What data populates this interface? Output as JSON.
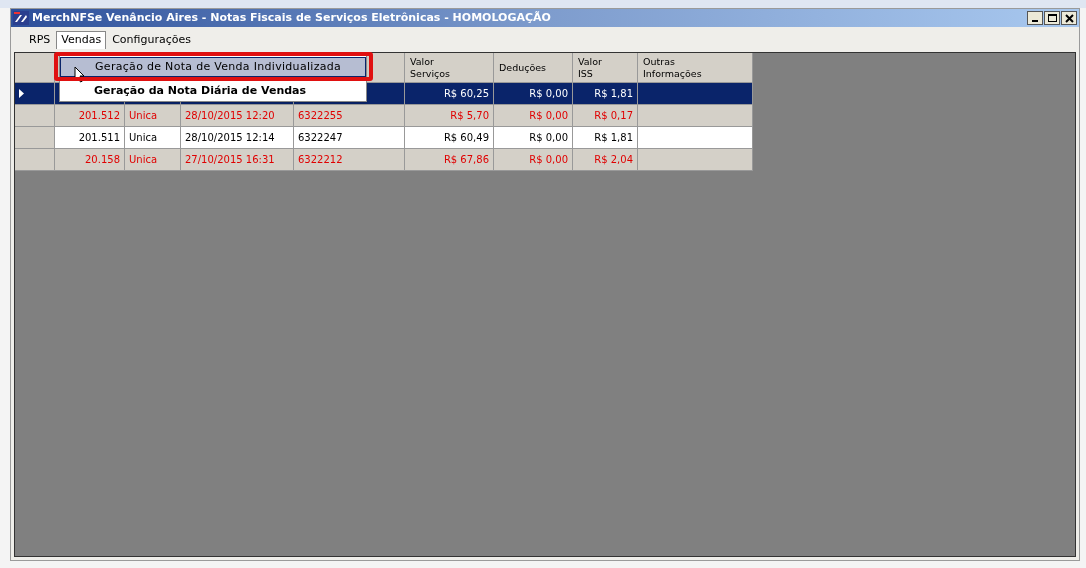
{
  "window": {
    "title": "MerchNFSe Venâncio Aires - Notas Fiscais de Serviços Eletrônicas - HOMOLOGAÇÃO"
  },
  "menu_bar": [
    {
      "label": "RPS",
      "selected": false
    },
    {
      "label": "Vendas",
      "selected": true
    },
    {
      "label": "Configurações",
      "selected": false
    }
  ],
  "open_menu": {
    "items": [
      {
        "label": "Geração de Nota de Venda Individualizada",
        "selected": true
      },
      {
        "label": "Geração da Nota Diária de Vendas",
        "selected": false
      }
    ]
  },
  "table": {
    "columns": [
      {},
      {},
      {},
      {},
      {
        "label": "Valor\nServiços"
      },
      {
        "label": "Deduções"
      },
      {
        "label": "Valor\nISS"
      },
      {
        "label": "Outras\nInformações"
      }
    ],
    "rows": [
      {
        "selected": true,
        "cells": [
          "",
          "",
          "",
          "",
          "R$ 60,25",
          "R$ 0,00",
          "R$ 1,81",
          ""
        ]
      },
      {
        "selected": false,
        "color": "#e00000",
        "cells": [
          "201.512",
          "Unica",
          "28/10/2015 12:20",
          "6322255",
          "R$ 5,70",
          "R$ 0,00",
          "R$ 0,17",
          ""
        ]
      },
      {
        "selected": false,
        "color": "#000000",
        "cells": [
          "201.511",
          "Unica",
          "28/10/2015 12:14",
          "6322247",
          "R$ 60,49",
          "R$ 0,00",
          "R$ 1,81",
          ""
        ]
      },
      {
        "selected": false,
        "color": "#e00000",
        "cells": [
          "20.158",
          "Unica",
          "27/10/2015 16:31",
          "6322212",
          "R$ 67,86",
          "R$ 0,00",
          "R$ 2,04",
          ""
        ]
      }
    ]
  }
}
